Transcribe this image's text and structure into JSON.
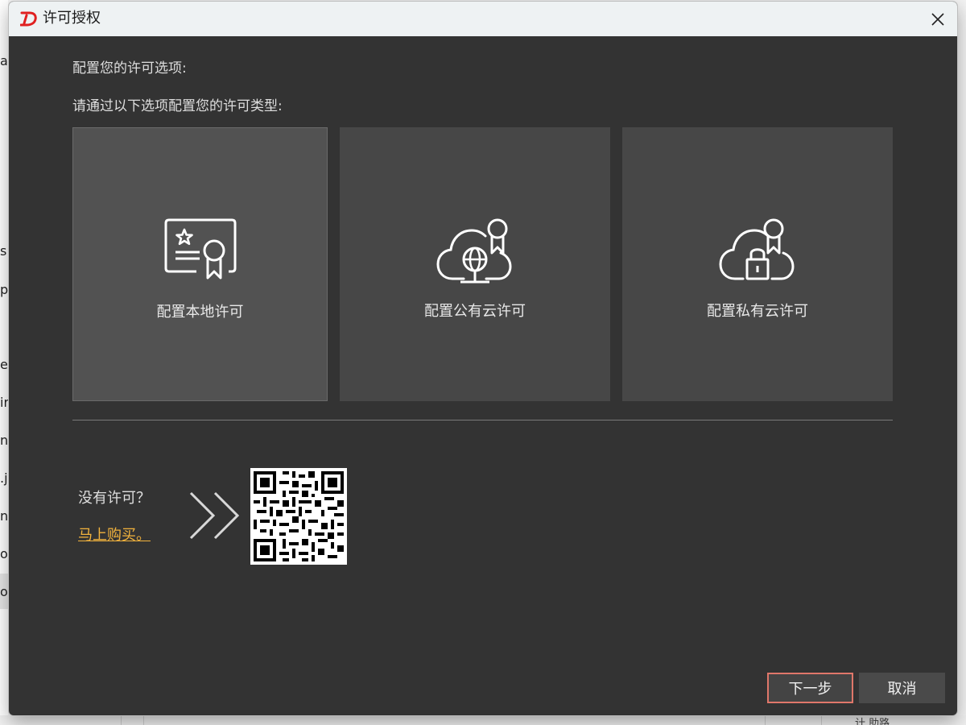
{
  "window": {
    "title": "许可授权",
    "logo_icon": "d-logo-icon",
    "accent": "#e0776a"
  },
  "heading": "配置您的许可选项:",
  "instruction": "请通过以下选项配置您的许可类型:",
  "options": [
    {
      "label": "配置本地许可",
      "icon": "certificate-icon",
      "selected": true
    },
    {
      "label": "配置公有云许可",
      "icon": "cloud-globe-award-icon",
      "selected": false
    },
    {
      "label": "配置私有云许可",
      "icon": "cloud-lock-award-icon",
      "selected": false
    }
  ],
  "purchase": {
    "prompt": "没有许可？",
    "link": "马上购买。",
    "link_color": "#f2b33d"
  },
  "buttons": {
    "next": "下一步",
    "cancel": "取消"
  },
  "background_fragments": [
    "at",
    "s",
    "p",
    "es",
    "ir",
    "nl",
    ".j",
    "nt",
    "oa",
    "op"
  ],
  "background_bottom_text": "计 助路"
}
